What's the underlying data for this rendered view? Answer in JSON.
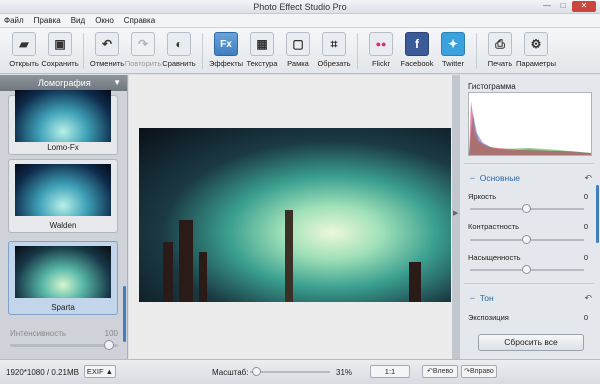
{
  "window": {
    "title": "Photo Effect Studio Pro",
    "minimize": "—",
    "maximize": "□",
    "close": "✕"
  },
  "menu": [
    "Файл",
    "Правка",
    "Вид",
    "Окно",
    "Справка"
  ],
  "toolbar": [
    {
      "label": "Открыть",
      "icon": "folder-icon",
      "glyph": "▰"
    },
    {
      "label": "Сохранить",
      "icon": "save-icon",
      "glyph": "▣"
    },
    {
      "label": "Отменить",
      "icon": "undo-icon",
      "glyph": "↶"
    },
    {
      "label": "Повторить",
      "icon": "redo-icon",
      "glyph": "↷"
    },
    {
      "label": "Сравнить",
      "icon": "compare-icon",
      "glyph": "◐"
    },
    {
      "label": "Эффекты",
      "icon": "effects-icon",
      "glyph": "Fx"
    },
    {
      "label": "Текстура",
      "icon": "texture-icon",
      "glyph": "▦"
    },
    {
      "label": "Рамка",
      "icon": "frame-icon",
      "glyph": "▢"
    },
    {
      "label": "Обрезать",
      "icon": "crop-icon",
      "glyph": "⌗"
    },
    {
      "label": "Flickr",
      "icon": "flickr-icon",
      "glyph": "●●"
    },
    {
      "label": "Facebook",
      "icon": "facebook-icon",
      "glyph": "f"
    },
    {
      "label": "Twitter",
      "icon": "twitter-icon",
      "glyph": "✦"
    },
    {
      "label": "Печать",
      "icon": "print-icon",
      "glyph": "⎙"
    },
    {
      "label": "Параметры",
      "icon": "settings-icon",
      "glyph": "⚙"
    }
  ],
  "left_panel": {
    "category": "Ломография",
    "effects": [
      "Lomo-Fx",
      "Walden",
      "Sparta"
    ],
    "intensity_label": "Интенсивность",
    "intensity_value": "100"
  },
  "right_panel": {
    "histogram_title": "Гистограмма",
    "sections": [
      {
        "title": "Основные",
        "rows": [
          {
            "label": "Яркость",
            "value": "0"
          },
          {
            "label": "Контрастность",
            "value": "0"
          },
          {
            "label": "Насыщенность",
            "value": "0"
          }
        ]
      },
      {
        "title": "Тон",
        "rows": [
          {
            "label": "Экспозиция",
            "value": "0"
          }
        ]
      }
    ],
    "reset_label": "Сбросить все"
  },
  "status": {
    "size": "1920*1080 / 0.21MB",
    "exif": "EXIF ▲",
    "zoom_label": "Масштаб:",
    "zoom_value": "31%",
    "one_to_one": "1:1",
    "rotate_left": "↶Влево",
    "rotate_right": "↷Вправо"
  },
  "colors": {
    "accent": "#3f7fc0",
    "close": "#c9463d"
  }
}
